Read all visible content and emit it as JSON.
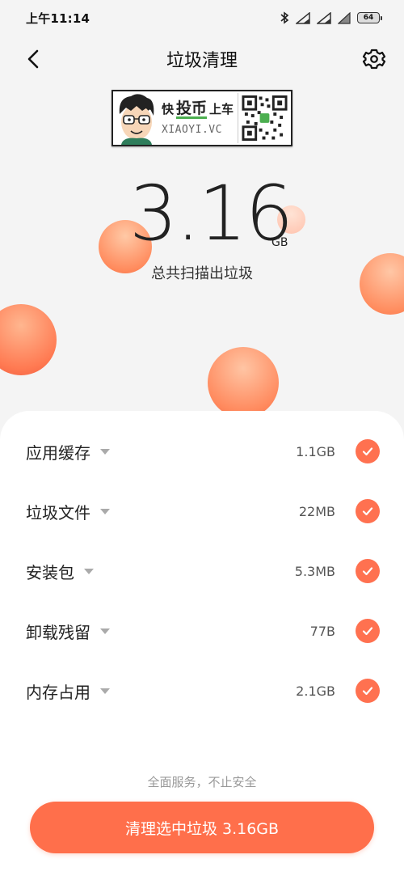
{
  "status_bar": {
    "time": "上午11:14",
    "battery": "64",
    "icons": [
      "bluetooth-icon",
      "signal-icon",
      "signal-icon",
      "wifi-icon",
      "battery-icon"
    ]
  },
  "nav": {
    "title": "垃圾清理",
    "back_icon": "chevron-left-icon",
    "settings_icon": "gear-icon"
  },
  "banner": {
    "line1_a": "快",
    "line1_b": "投币",
    "line1_c": "上车",
    "line2": "XIAOYI.VC"
  },
  "summary": {
    "size": "3.16",
    "unit": "GB",
    "caption": "总共扫描出垃圾"
  },
  "items": [
    {
      "label": "应用缓存",
      "size": "1.1GB",
      "checked": true
    },
    {
      "label": "垃圾文件",
      "size": "22MB",
      "checked": true
    },
    {
      "label": "安装包",
      "size": "5.3MB",
      "checked": true
    },
    {
      "label": "卸载残留",
      "size": "77B",
      "checked": true
    },
    {
      "label": "内存占用",
      "size": "2.1GB",
      "checked": true
    }
  ],
  "footer": {
    "slogan": "全面服务，不止安全",
    "clean_button": "清理选中垃圾 3.16GB"
  },
  "colors": {
    "accent": "#ff6f4b",
    "check": "#ff7150",
    "background": "#f4f4f4"
  }
}
